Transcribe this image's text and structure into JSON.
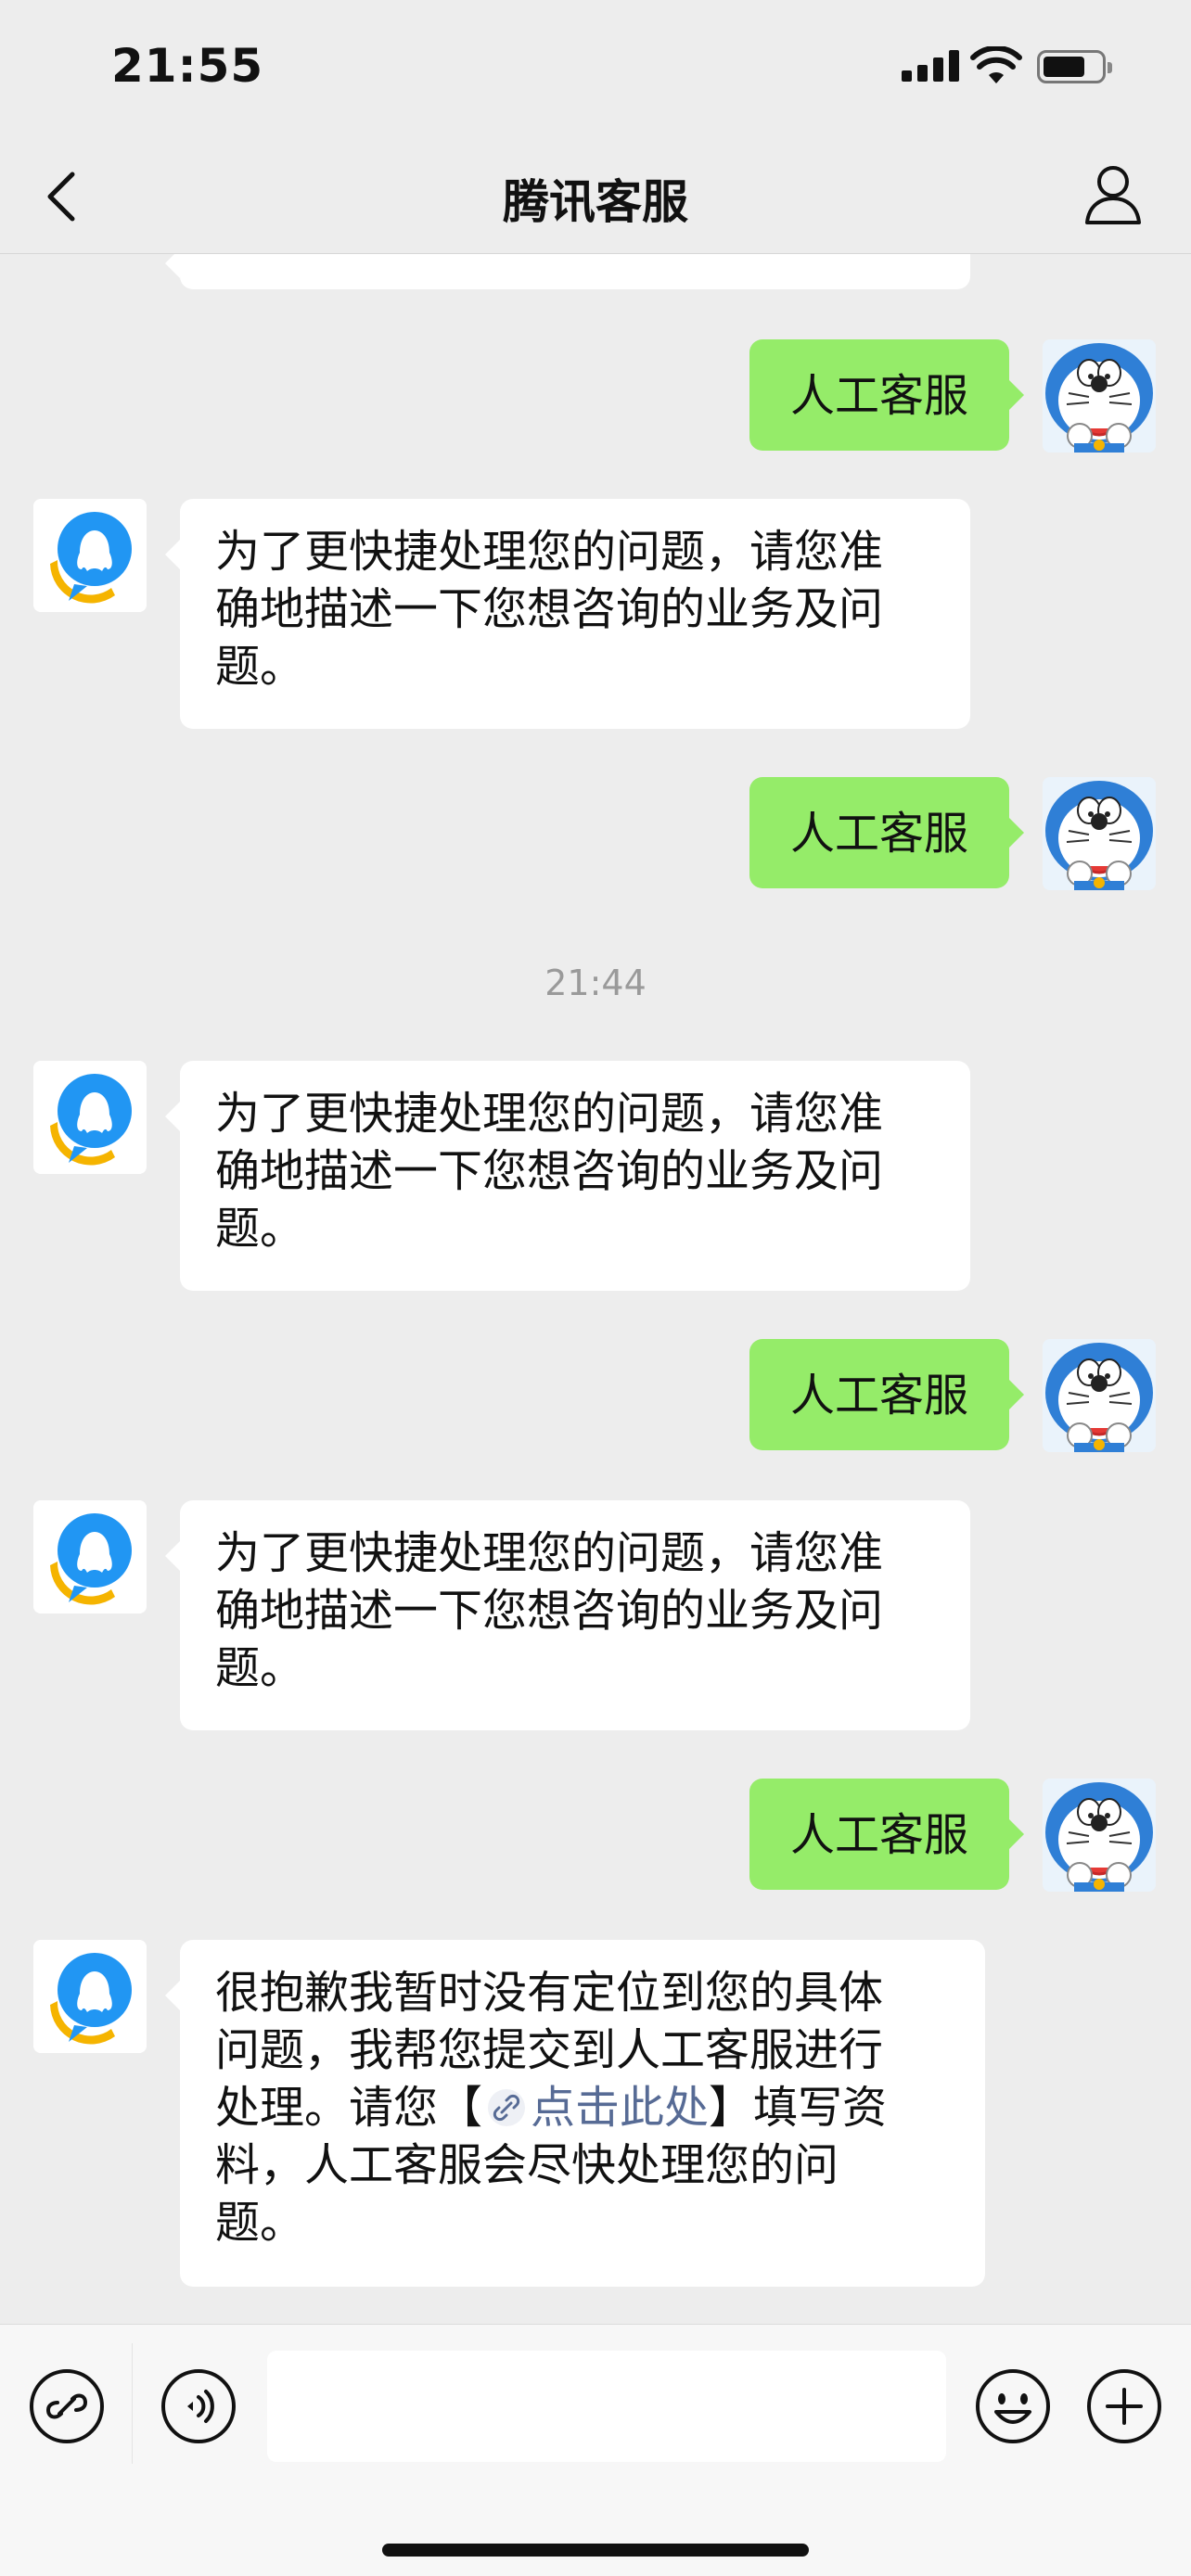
{
  "status_bar": {
    "time": "21:55",
    "icons": [
      "cellular-signal-icon",
      "wifi-icon",
      "battery-icon"
    ]
  },
  "nav": {
    "title": "腾讯客服",
    "back_icon": "chevron-left-icon",
    "profile_icon": "person-icon"
  },
  "messages": {
    "m0": {
      "sender": "user",
      "text": "人工客服"
    },
    "m1": {
      "sender": "bot",
      "line1": "为了更快捷处理您的问题，请您准",
      "line2": "确地描述一下您想咨询的业务及问",
      "line3": "题。"
    },
    "m2": {
      "sender": "user",
      "text": "人工客服"
    },
    "time_divider": "21:44",
    "m3": {
      "sender": "bot",
      "line1": "为了更快捷处理您的问题，请您准",
      "line2": "确地描述一下您想咨询的业务及问",
      "line3": "题。"
    },
    "m4": {
      "sender": "user",
      "text": "人工客服"
    },
    "m5": {
      "sender": "bot",
      "line1": "为了更快捷处理您的问题，请您准",
      "line2": "确地描述一下您想咨询的业务及问",
      "line3": "题。"
    },
    "m6": {
      "sender": "user",
      "text": "人工客服"
    },
    "m7": {
      "sender": "bot",
      "line1": "很抱歉我暂时没有定位到您的具体",
      "line2": "问题，我帮您提交到人工客服进行",
      "line3_before": "处理。请您【",
      "link_text": "点击此处",
      "line3_after": "】填写资",
      "line4": "料，人工客服会尽快处理您的问",
      "line5": "题。"
    }
  },
  "input_bar": {
    "placeholder": "",
    "icons": [
      "mini-program-link-icon",
      "voice-icon",
      "emoji-icon",
      "plus-icon"
    ]
  },
  "colors": {
    "background": "#ededed",
    "user_bubble": "#95ec69",
    "bot_bubble": "#ffffff",
    "link": "#576b95",
    "bot_avatar_blue": "#1e88e5",
    "bot_avatar_yellow": "#f5b400"
  }
}
